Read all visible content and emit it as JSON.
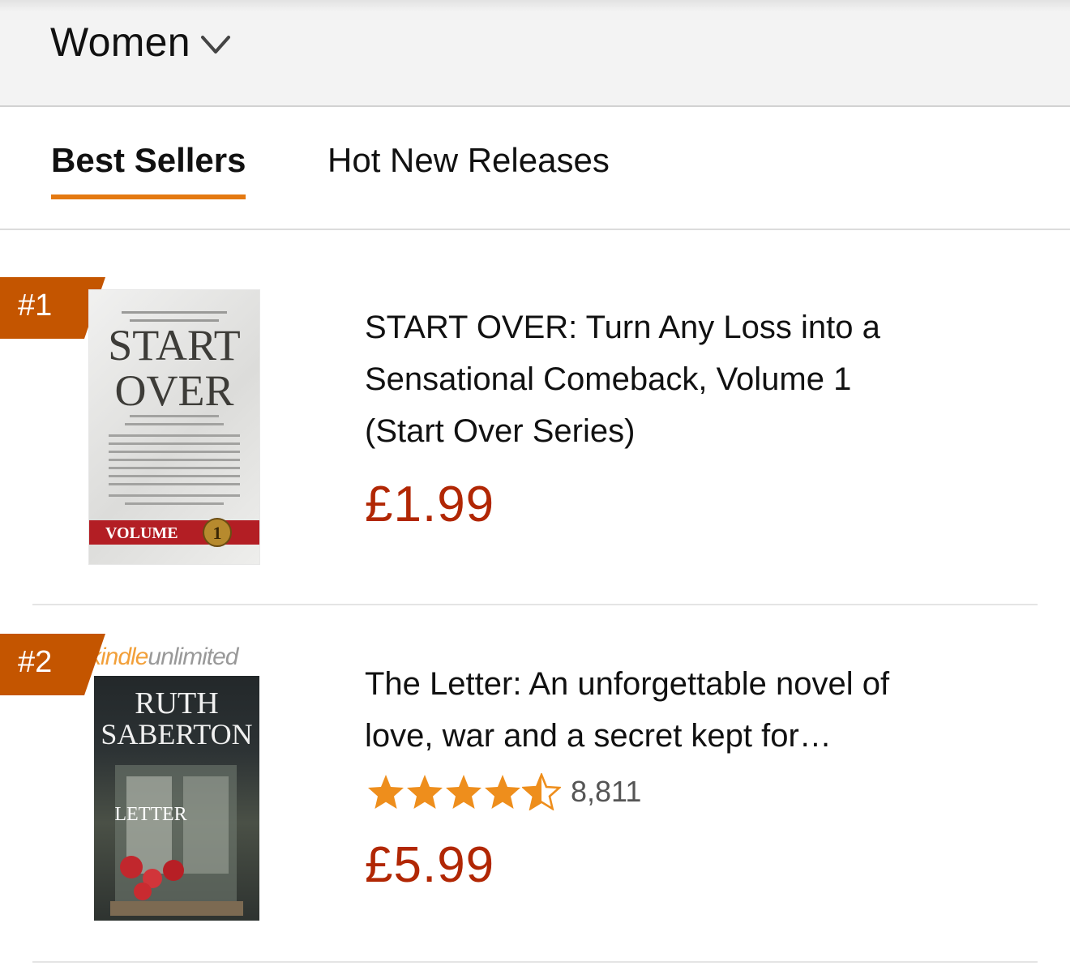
{
  "header": {
    "category": "Women"
  },
  "tabs": [
    {
      "label": "Best Sellers",
      "active": true
    },
    {
      "label": "Hot New Releases",
      "active": false
    }
  ],
  "items": [
    {
      "rank": "#1",
      "title_lines": [
        "START OVER: Turn Any Loss into a",
        "Sensational Comeback, Volume 1",
        "(Start Over Series)"
      ],
      "price": "£1.99",
      "cover": {
        "title_lines": [
          "START",
          "OVER"
        ],
        "volume_label": "VOLUME",
        "volume_number": "1"
      }
    },
    {
      "rank": "#2",
      "title_lines": [
        "The Letter: An unforgettable novel of",
        "love, war and a secret kept for…"
      ],
      "rating": {
        "stars": 4.5,
        "count": "8,811"
      },
      "price": "£5.99",
      "cover": {
        "badge": [
          "kindle",
          "unlimited"
        ],
        "author_lines": [
          "RUTH",
          "SABERTON"
        ],
        "title": "LETTER"
      }
    }
  ],
  "colors": {
    "rank_badge": "#c45500",
    "price": "#b12704",
    "tab_underline": "#e47911",
    "star": "#ee8e1c"
  }
}
